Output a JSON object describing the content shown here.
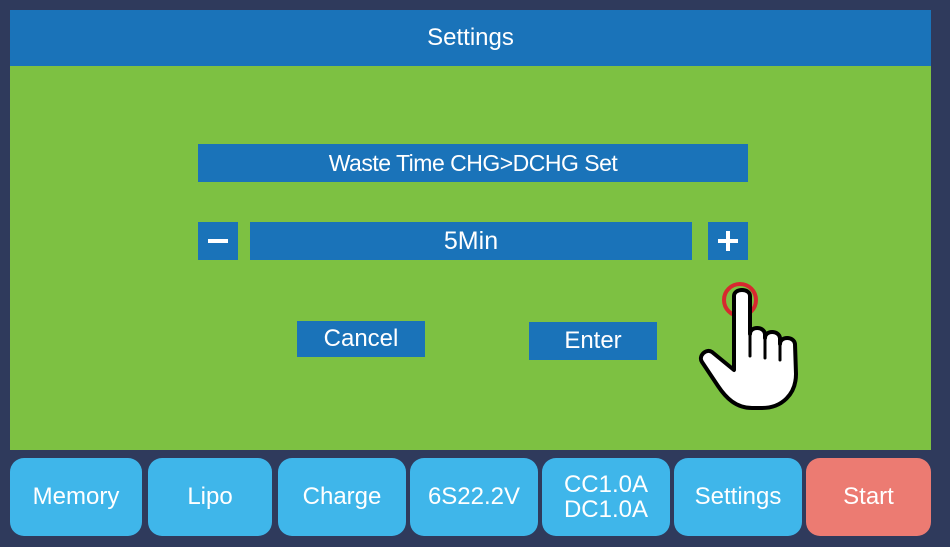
{
  "header": {
    "title": "Settings"
  },
  "dialog": {
    "prompt": "Waste Time CHG>DCHG Set",
    "value": "5Min",
    "cancel_label": "Cancel",
    "enter_label": "Enter"
  },
  "tabs": [
    {
      "label": "Memory"
    },
    {
      "label": "Lipo"
    },
    {
      "label": "Charge"
    },
    {
      "label": "6S22.2V"
    },
    {
      "label_line1": "CC1.0A",
      "label_line2": "DC1.0A"
    },
    {
      "label": "Settings"
    },
    {
      "label": "Start"
    }
  ],
  "colors": {
    "title_bar": "#1a73b9",
    "background": "#7dc142",
    "tab": "#3fb6ea",
    "start_tab": "#ec7b72",
    "frame": "#2f3a5c",
    "tap_indicator": "#d7282f"
  },
  "icons": {
    "decrease": "minus-icon",
    "increase": "plus-icon",
    "pointer": "hand-pointer-icon"
  }
}
